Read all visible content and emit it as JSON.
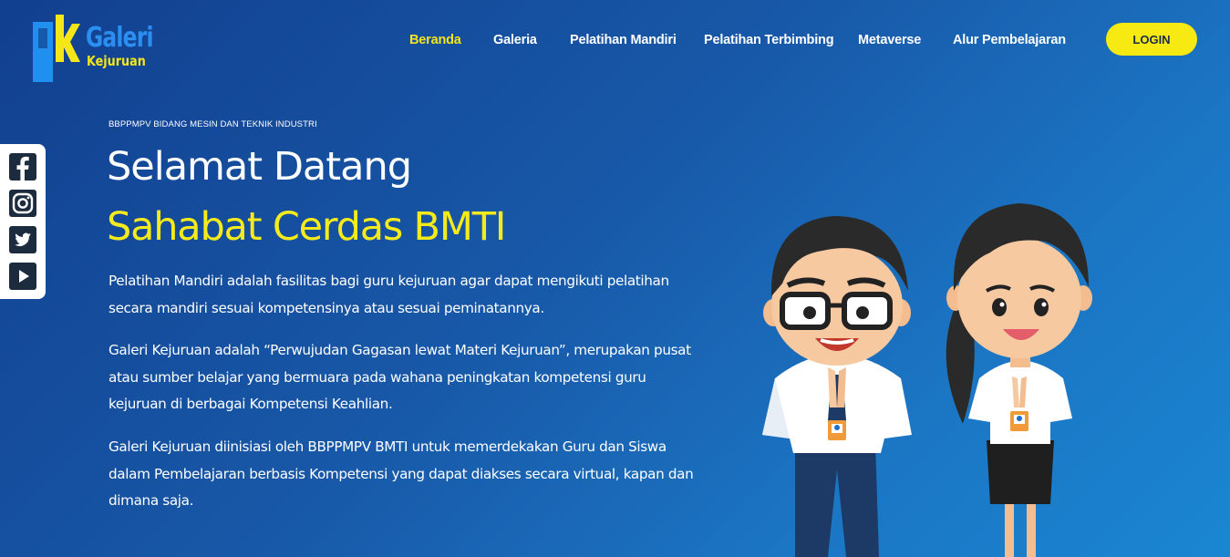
{
  "header": {
    "logo": {
      "line1": "Galeri",
      "line2": "Kejuruan",
      "monogram": "gk"
    },
    "nav": [
      {
        "label": "Beranda",
        "active": true
      },
      {
        "label": "Galeria",
        "active": false
      },
      {
        "label": "Pelatihan Mandiri",
        "active": false
      },
      {
        "label": "Pelatihan Terbimbing",
        "active": false
      },
      {
        "label": "Metaverse",
        "active": false
      },
      {
        "label": "Alur Pembelajaran",
        "active": false
      }
    ],
    "login_label": "LOGIN"
  },
  "social": [
    {
      "name": "facebook-icon"
    },
    {
      "name": "instagram-icon"
    },
    {
      "name": "twitter-icon"
    },
    {
      "name": "youtube-icon"
    }
  ],
  "hero": {
    "eyebrow": "BBPPMPV BIDANG MESIN DAN TEKNIK INDUSTRI",
    "title_line1": "Selamat Datang",
    "title_line2": "Sahabat Cerdas BMTI",
    "paragraphs": [
      "Pelatihan Mandiri adalah fasilitas bagi guru kejuruan agar dapat mengikuti pelatihan secara mandiri sesuai kompetensinya atau sesuai peminatannya.",
      "Galeri Kejuruan adalah “Perwujudan Gagasan lewat Materi Kejuruan”, merupakan pusat atau sumber belajar yang bermuara pada wahana peningkatan kompetensi guru kejuruan di berbagai Kompetensi Keahlian.",
      "Galeri Kejuruan diinisiasi oleh BBPPMPV BMTI untuk memerdekakan Guru dan Siswa dalam Pembelajaran berbasis Kompetensi yang dapat diakses secara virtual, kapan dan dimana saja."
    ]
  },
  "colors": {
    "accent_yellow": "#f6e41c",
    "bg_dark": "#123f8f",
    "bg_light": "#1a86d2"
  }
}
